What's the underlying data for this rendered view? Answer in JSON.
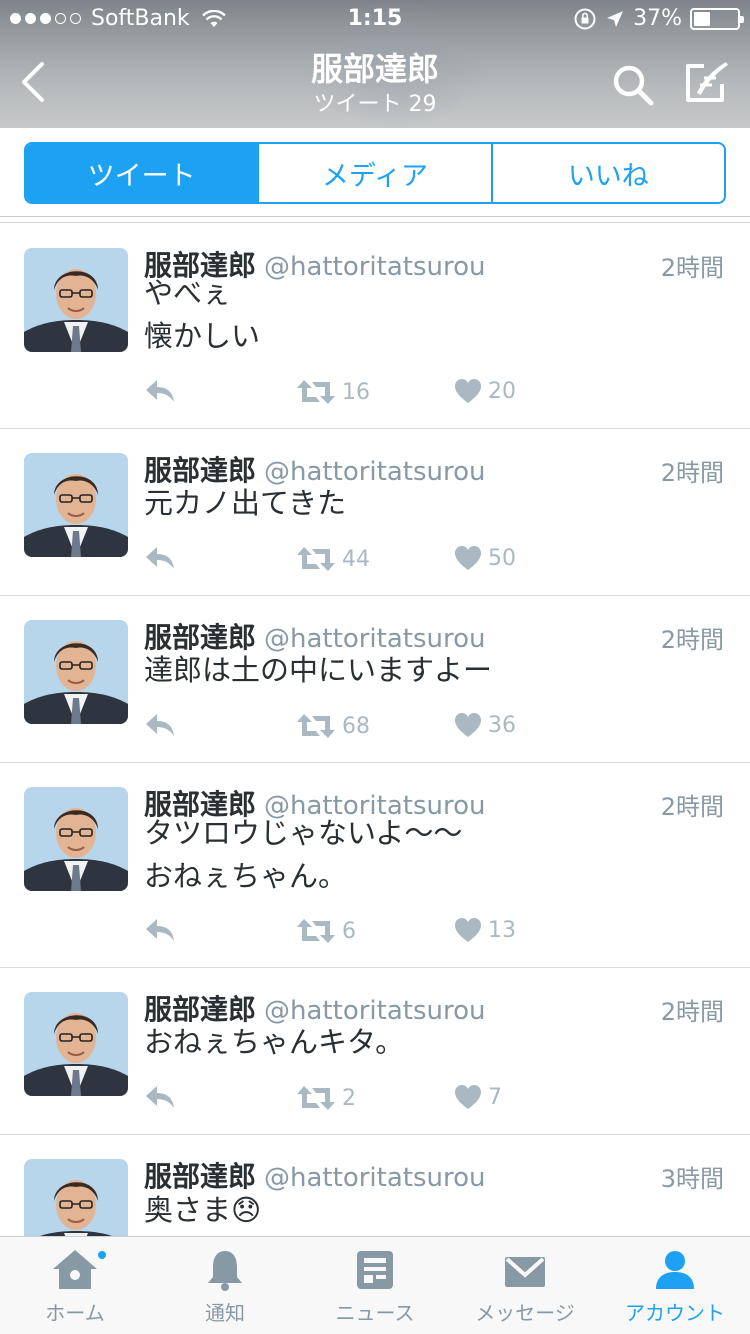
{
  "status_bar": {
    "signal_dots_filled": 3,
    "signal_dots_total": 5,
    "carrier": "SoftBank",
    "time": "1:15",
    "battery_percent_label": "37%",
    "battery_level": 0.37
  },
  "nav": {
    "title": "服部達郎",
    "subtitle": "ツイート 29"
  },
  "segments": [
    "ツイート",
    "メディア",
    "いいね"
  ],
  "tweets": [
    {
      "name": "服部達郎",
      "handle": "@hattoritatsurou",
      "time": "2時間",
      "text": "やべぇ\n懐かしい",
      "retweets": "16",
      "likes": "20"
    },
    {
      "name": "服部達郎",
      "handle": "@hattoritatsurou",
      "time": "2時間",
      "text": "元カノ出てきた",
      "retweets": "44",
      "likes": "50"
    },
    {
      "name": "服部達郎",
      "handle": "@hattoritatsurou",
      "time": "2時間",
      "text": "達郎は土の中にいますよー",
      "retweets": "68",
      "likes": "36"
    },
    {
      "name": "服部達郎",
      "handle": "@hattoritatsurou",
      "time": "2時間",
      "text": "タツロウじゃないよ〜〜\nおねぇちゃん。",
      "retweets": "6",
      "likes": "13"
    },
    {
      "name": "服部達郎",
      "handle": "@hattoritatsurou",
      "time": "2時間",
      "text": "おねぇちゃんキタ。",
      "retweets": "2",
      "likes": "7"
    },
    {
      "name": "服部達郎",
      "handle": "@hattoritatsurou",
      "time": "3時間",
      "text": "奥さま😞",
      "retweets": "",
      "likes": ""
    }
  ],
  "tabbar": {
    "home": "ホーム",
    "notifications": "通知",
    "news": "ニュース",
    "messages": "メッセージ",
    "account": "アカウント"
  },
  "colors": {
    "accent": "#1da1f2",
    "muted": "#8899a6",
    "action_gray": "#aab8c2"
  }
}
